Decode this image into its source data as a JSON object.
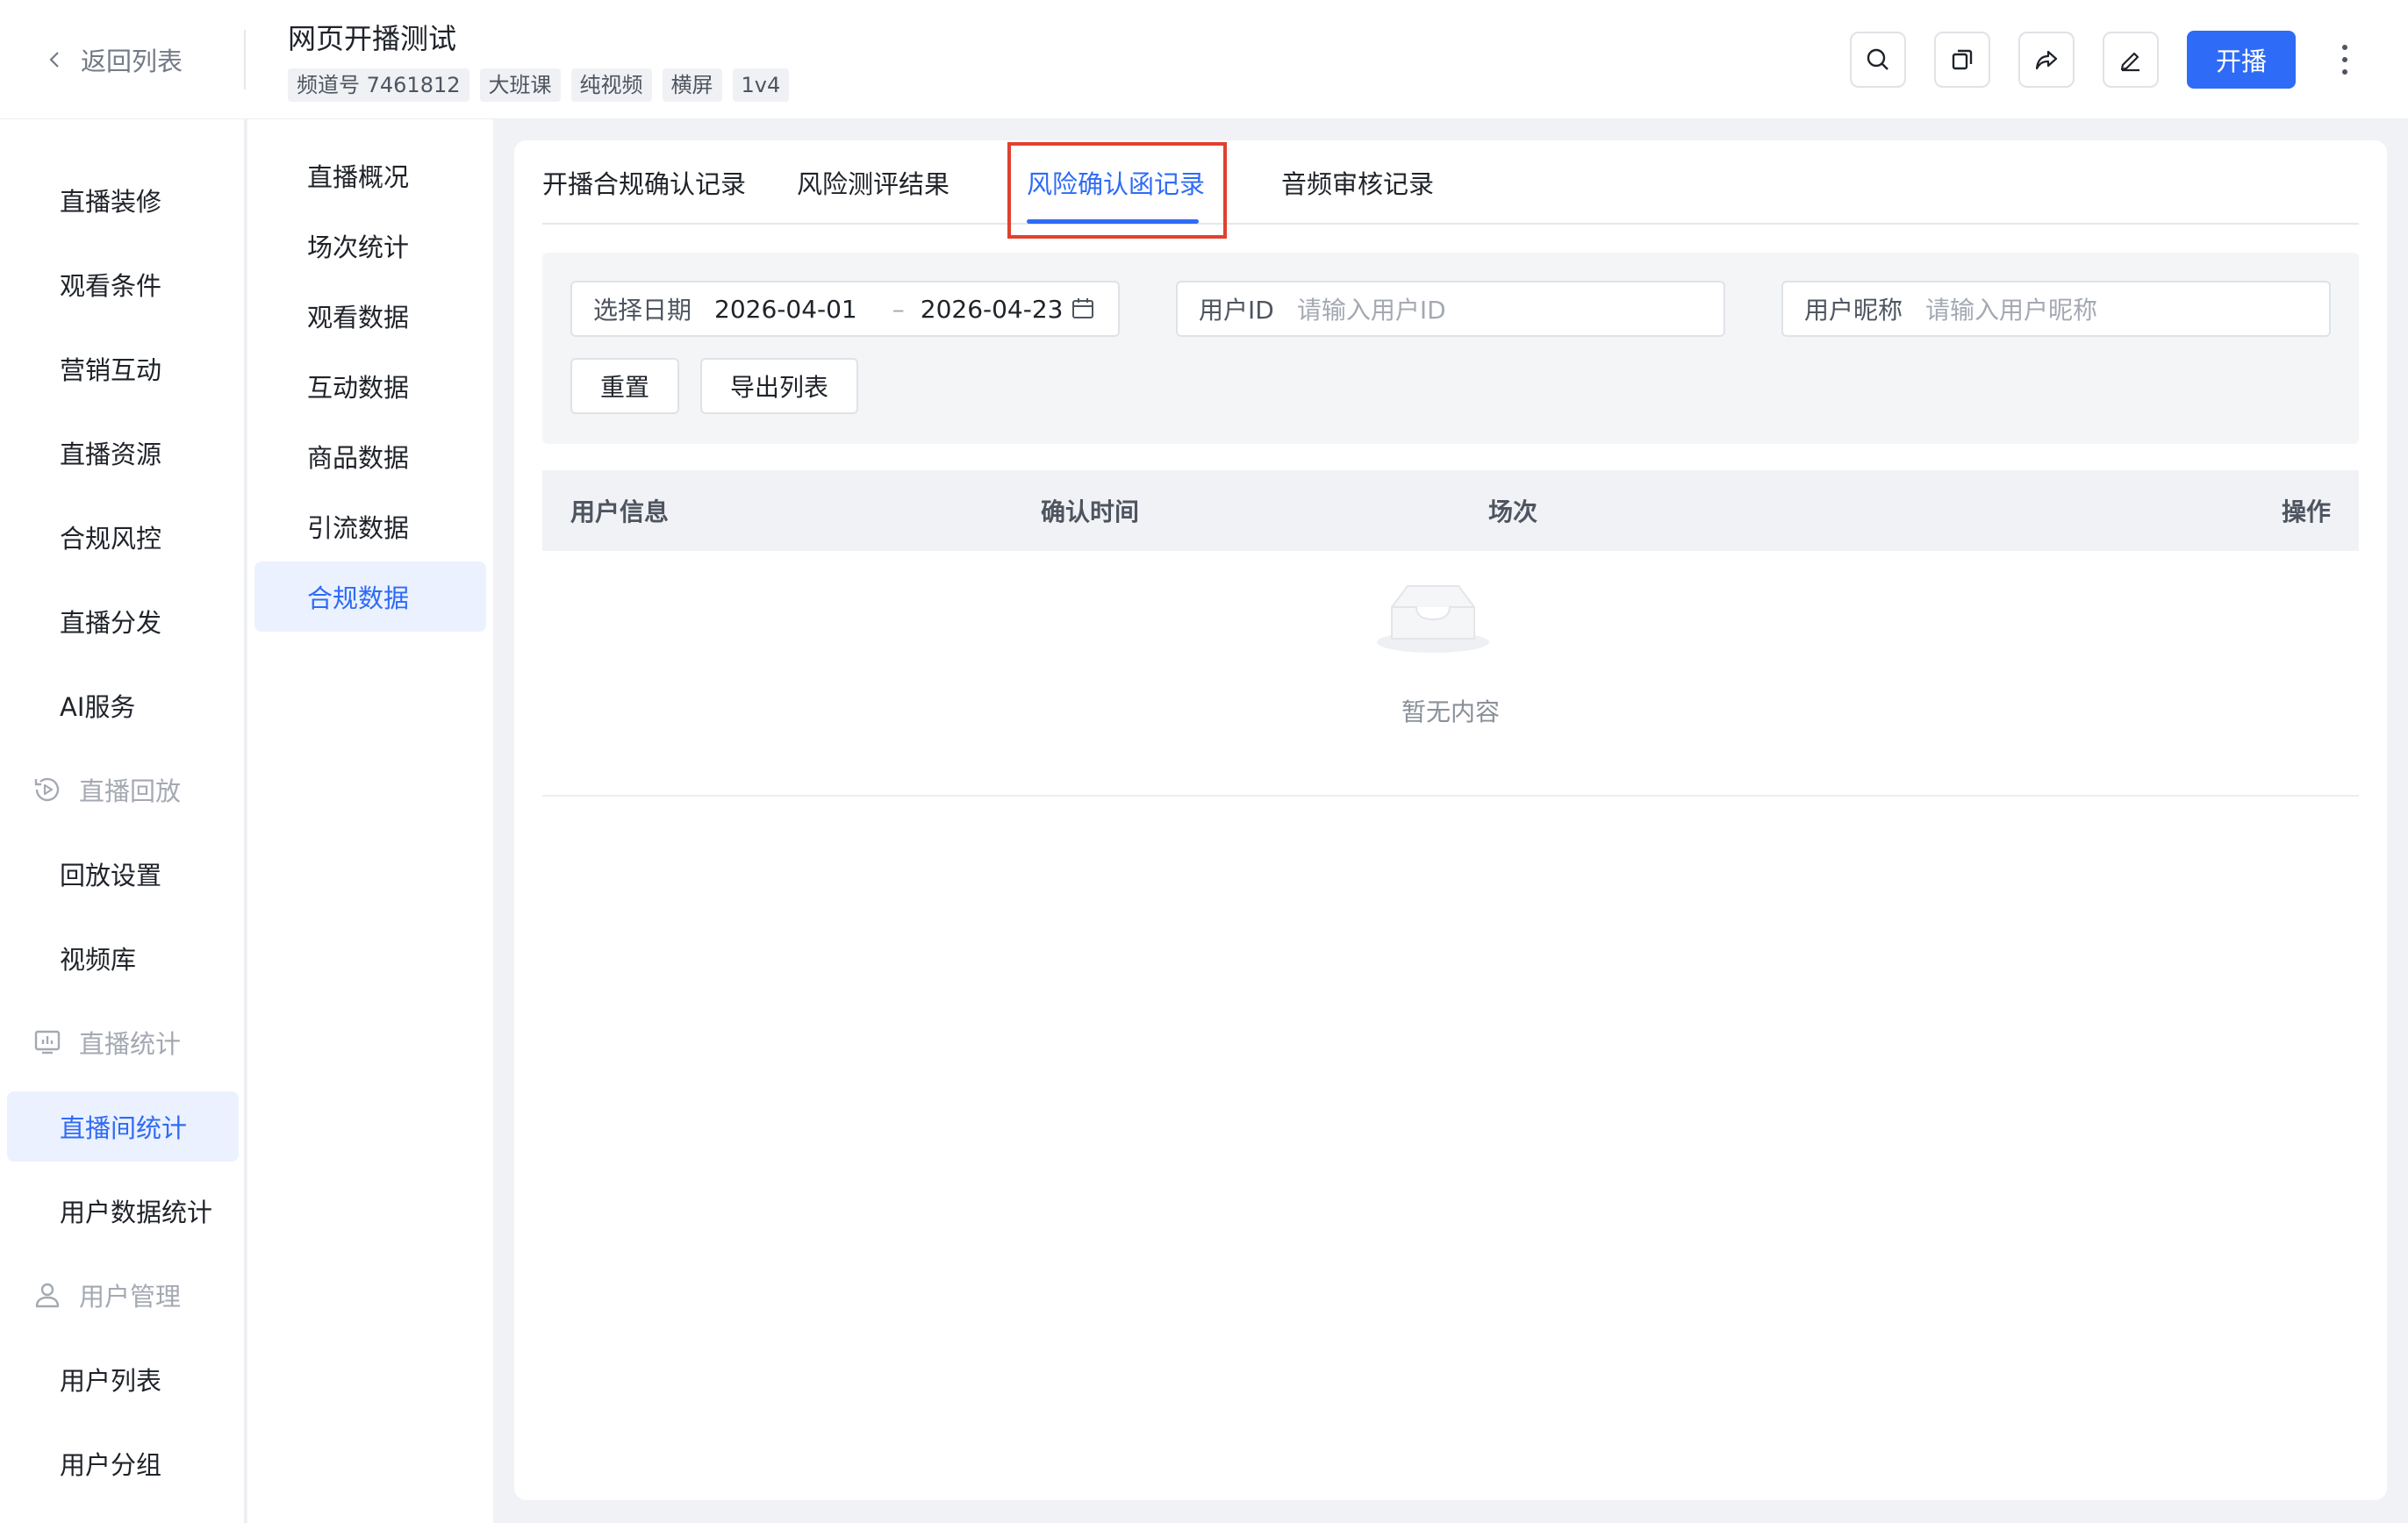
{
  "header": {
    "back_label": "返回列表",
    "title": "网页开播测试",
    "tags": [
      "频道号 7461812",
      "大班课",
      "纯视频",
      "横屏",
      "1v4"
    ],
    "start_label": "开播"
  },
  "sidebar": {
    "items": [
      {
        "label": "直播装修"
      },
      {
        "label": "观看条件"
      },
      {
        "label": "营销互动"
      },
      {
        "label": "直播资源"
      },
      {
        "label": "合规风控"
      },
      {
        "label": "直播分发"
      },
      {
        "label": "AI服务"
      }
    ],
    "group_replay": "直播回放",
    "replay_items": [
      {
        "label": "回放设置"
      },
      {
        "label": "视频库"
      }
    ],
    "group_stats": "直播统计",
    "stats_items": [
      {
        "label": "直播间统计"
      },
      {
        "label": "用户数据统计"
      }
    ],
    "group_users": "用户管理",
    "user_items": [
      {
        "label": "用户列表"
      },
      {
        "label": "用户分组"
      }
    ]
  },
  "submenu": {
    "items": [
      {
        "label": "直播概况"
      },
      {
        "label": "场次统计"
      },
      {
        "label": "观看数据"
      },
      {
        "label": "互动数据"
      },
      {
        "label": "商品数据"
      },
      {
        "label": "引流数据"
      },
      {
        "label": "合规数据"
      }
    ]
  },
  "tabs": [
    {
      "label": "开播合规确认记录"
    },
    {
      "label": "风险测评结果"
    },
    {
      "label": "风险确认函记录"
    },
    {
      "label": "音频审核记录"
    }
  ],
  "filters": {
    "date_label": "选择日期",
    "date_start": "2026-04-01",
    "date_sep": "–",
    "date_end": "2026-04-23",
    "user_id_label": "用户ID",
    "user_id_placeholder": "请输入用户ID",
    "nickname_label": "用户昵称",
    "nickname_placeholder": "请输入用户昵称",
    "reset_label": "重置",
    "export_label": "导出列表"
  },
  "table": {
    "columns": [
      "用户信息",
      "确认时间",
      "场次",
      "操作"
    ],
    "empty_text": "暂无内容"
  },
  "colors": {
    "accent": "#2e6bf6",
    "highlight_box": "#e0412f"
  }
}
